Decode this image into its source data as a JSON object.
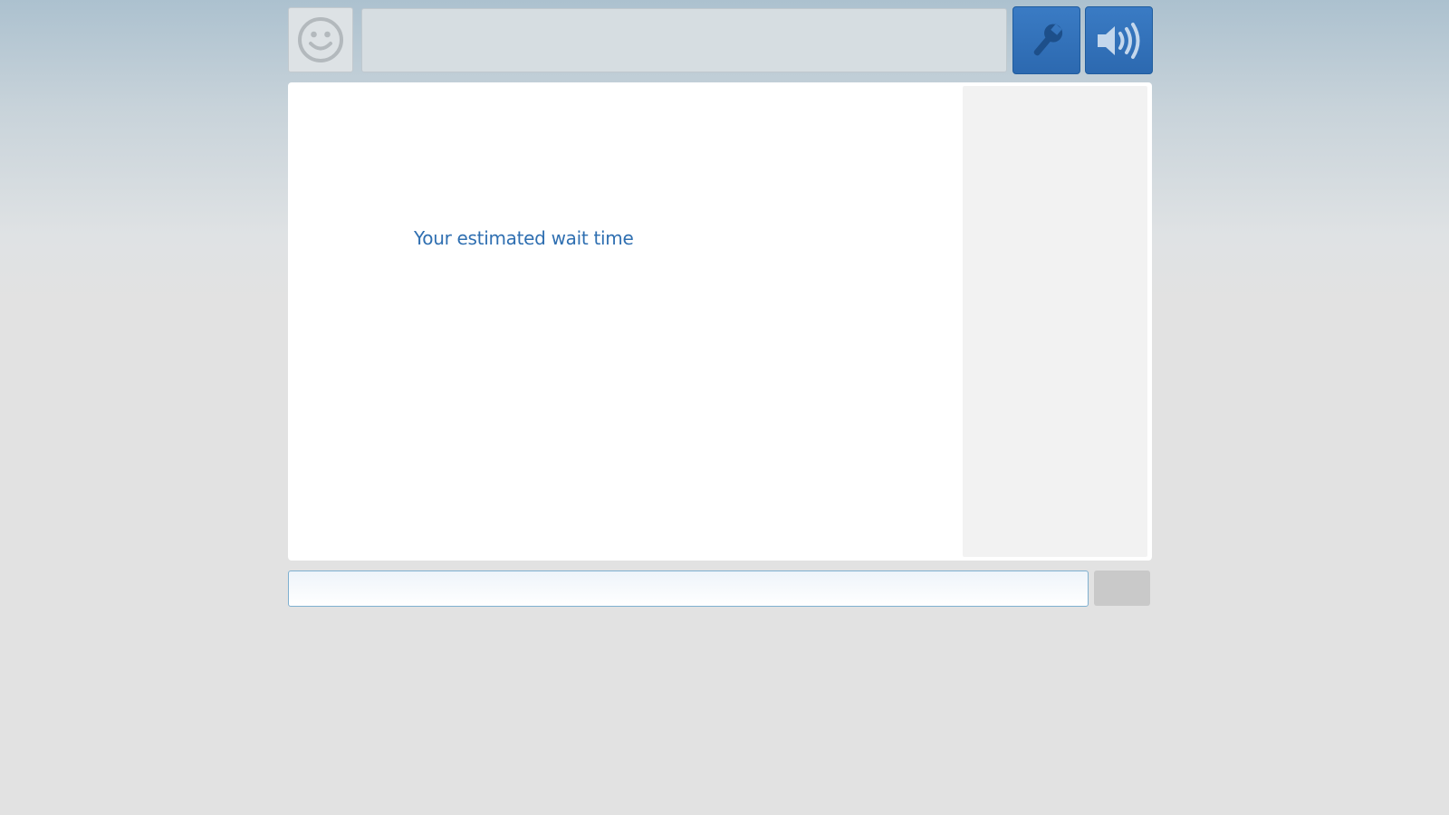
{
  "header": {
    "avatar_icon": "smiley-face-icon",
    "title": "",
    "settings_icon": "wrench-icon",
    "sound_icon": "speaker-icon"
  },
  "chat": {
    "status_message": "Your estimated wait time"
  },
  "footer": {
    "message_value": "",
    "message_placeholder": "",
    "send_label": ""
  },
  "colors": {
    "accent": "#2c69b0",
    "status_text": "#2f6fb1",
    "side_panel": "#f2f2f2",
    "send_button_disabled": "#c9c9c9"
  }
}
